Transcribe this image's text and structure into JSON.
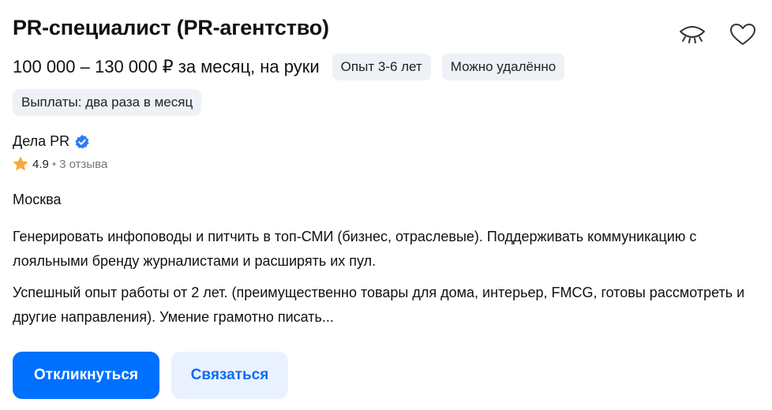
{
  "vacancy": {
    "title": "PR-специалист (PR-агентство)",
    "salary": "100 000 – 130 000 ₽ за месяц, на руки",
    "tags": [
      "Опыт 3-6 лет",
      "Можно удалённо"
    ],
    "payments": "Выплаты: два раза в месяц"
  },
  "company": {
    "name": "Дела PR",
    "rating": "4.9",
    "separator": "•",
    "reviews": "3 отзыва"
  },
  "location": "Москва",
  "description": {
    "responsibilities": "Генерировать инфоповоды и питчить в топ-СМИ (бизнес, отраслевые). Поддерживать коммуникацию с лояльными бренду журналистами и расширять их пул.",
    "requirements": "Успешный опыт работы от 2 лет. (преимущественно товары для дома, интерьер, FMCG, готовы рассмотреть и другие направления). Умение грамотно писать..."
  },
  "actions": {
    "apply_label": "Откликнуться",
    "contact_label": "Связаться"
  },
  "icons": {
    "hide": "eye-closed-icon",
    "favorite": "heart-icon",
    "verified": "verified-badge-icon",
    "rating": "star-icon"
  },
  "colors": {
    "accent": "#0070ff",
    "accent_light": "#eaf2ff",
    "chip_bg": "#eef1f5",
    "star": "#f7a83b",
    "verified": "#2d7bf4"
  }
}
